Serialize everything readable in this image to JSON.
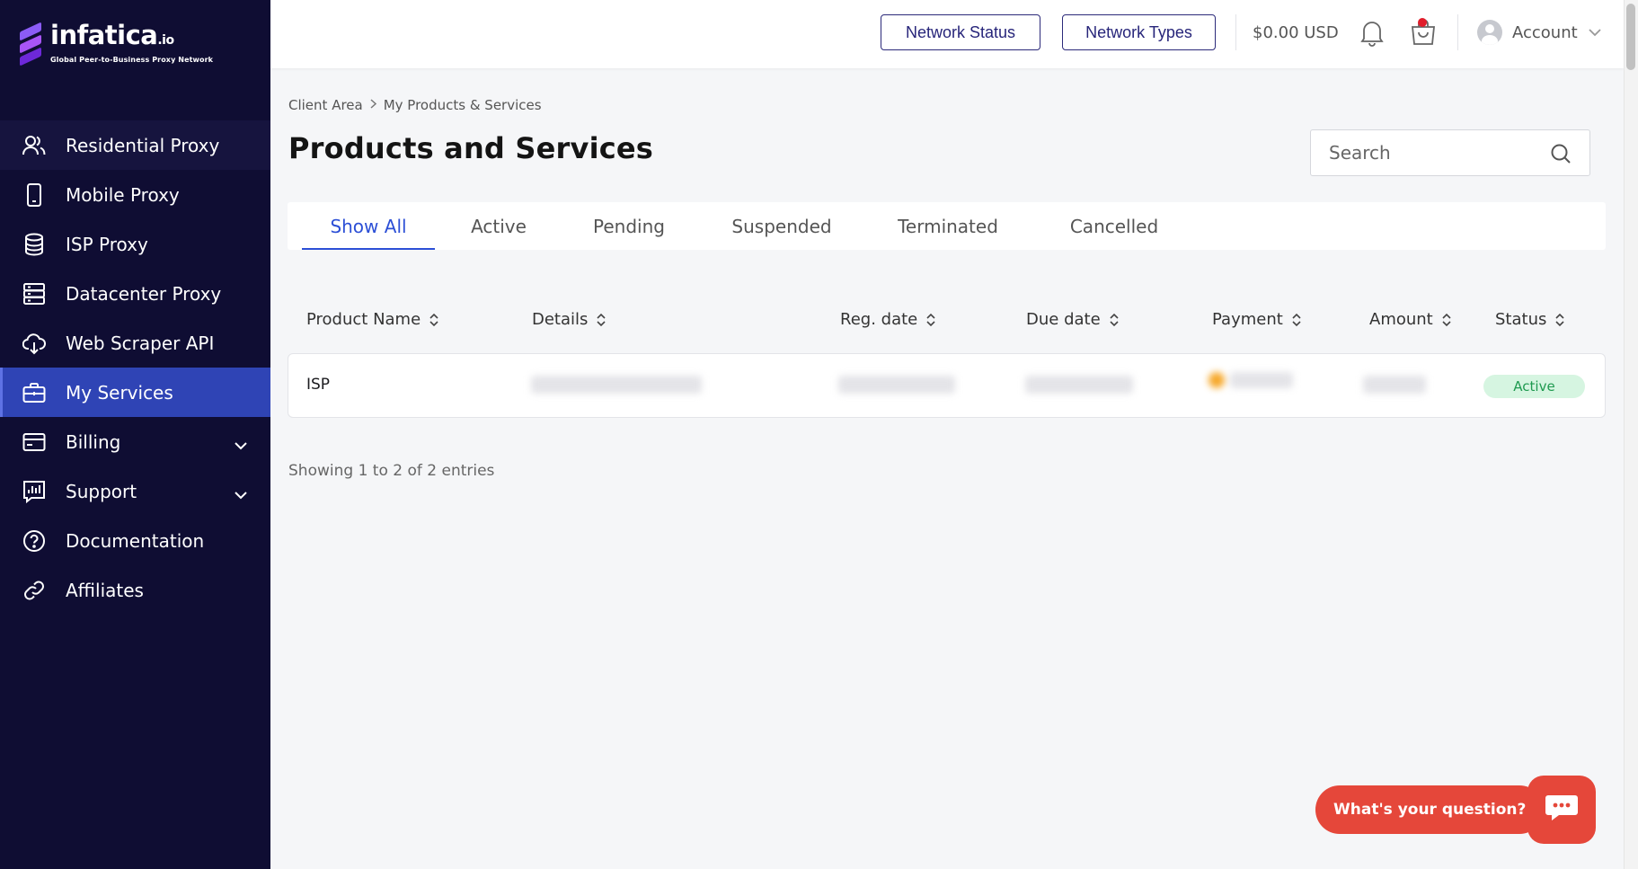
{
  "brand": {
    "name": "infatica",
    "suffix": ".io",
    "tagline": "Global Peer-to-Business Proxy Network",
    "colors": {
      "sidebar": "#0f0d33",
      "active": "#2f44b5",
      "accent": "#2c4fd6",
      "chat": "#e5473a"
    }
  },
  "sidebar": {
    "items": [
      {
        "label": "Residential Proxy",
        "icon": "users-icon"
      },
      {
        "label": "Mobile Proxy",
        "icon": "phone-icon"
      },
      {
        "label": "ISP Proxy",
        "icon": "database-icon"
      },
      {
        "label": "Datacenter Proxy",
        "icon": "server-icon"
      },
      {
        "label": "Web Scraper API",
        "icon": "cloud-download-icon"
      },
      {
        "label": "My Services",
        "icon": "briefcase-icon",
        "active": true
      },
      {
        "label": "Billing",
        "icon": "credit-card-icon",
        "expandable": true
      },
      {
        "label": "Support",
        "icon": "chart-icon",
        "expandable": true
      },
      {
        "label": "Documentation",
        "icon": "help-circle-icon"
      },
      {
        "label": "Affiliates",
        "icon": "link-icon"
      }
    ]
  },
  "topbar": {
    "network_status": "Network Status",
    "network_types": "Network Types",
    "balance": "$0.00 USD",
    "account": "Account"
  },
  "breadcrumb": {
    "root": "Client Area",
    "current": "My Products & Services"
  },
  "page": {
    "title": "Products and Services"
  },
  "search": {
    "placeholder": "Search"
  },
  "tabs": [
    "Show All",
    "Active",
    "Pending",
    "Suspended",
    "Terminated",
    "Cancelled"
  ],
  "table": {
    "headers": [
      "Product Name",
      "Details",
      "Reg. date",
      "Due date",
      "Payment",
      "Amount",
      "Status"
    ],
    "rows": [
      {
        "product": "ISP",
        "details": "",
        "reg_date": "",
        "due_date": "",
        "payment": "",
        "amount": "",
        "status": "Active"
      }
    ]
  },
  "entries": "Showing 1 to 2 of 2 entries",
  "chat": {
    "prompt": "What's your question?"
  }
}
